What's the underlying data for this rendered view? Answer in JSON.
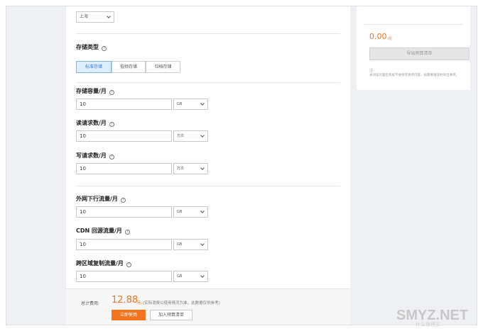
{
  "region": {
    "value": "上海"
  },
  "storage_type": {
    "label": "存储类型",
    "options": [
      "标准存储",
      "低频存储",
      "归档存储"
    ],
    "selected": "标准存储"
  },
  "fields": [
    {
      "label": "存储容量/月",
      "value": "10",
      "unit": "GB"
    },
    {
      "label": "读请求数/月",
      "value": "10",
      "unit": "万次"
    },
    {
      "label": "写请求数/月",
      "value": "10",
      "unit": "万次"
    },
    {
      "label": "外网下行流量/月",
      "value": "10",
      "unit": "GB"
    },
    {
      "label": "CDN 回源流量/月",
      "value": "10",
      "unit": "GB"
    },
    {
      "label": "跨区域复制流量/月",
      "value": "10",
      "unit": "GB"
    }
  ],
  "help_glyph": "?",
  "footer": {
    "total_label": "总计费用:",
    "total_amount": "12.88",
    "currency": "元",
    "note": "(实际消费以使用情况为准，此数据仅供参考)",
    "buy_button": "立即使用",
    "add_button": "加入预算清单"
  },
  "side": {
    "amount": "0.00",
    "currency": "元",
    "export_button": "导出预算清单",
    "note_title": "注",
    "note_text": "关闭该页面后系统不会保存清单内容，如需要请及时导出清单。"
  },
  "watermark": {
    "text": "SMYZ.NET",
    "sub": "什么值得买"
  },
  "colors": {
    "accent": "#f5731c",
    "primary_blue": "#3a7bd5"
  }
}
